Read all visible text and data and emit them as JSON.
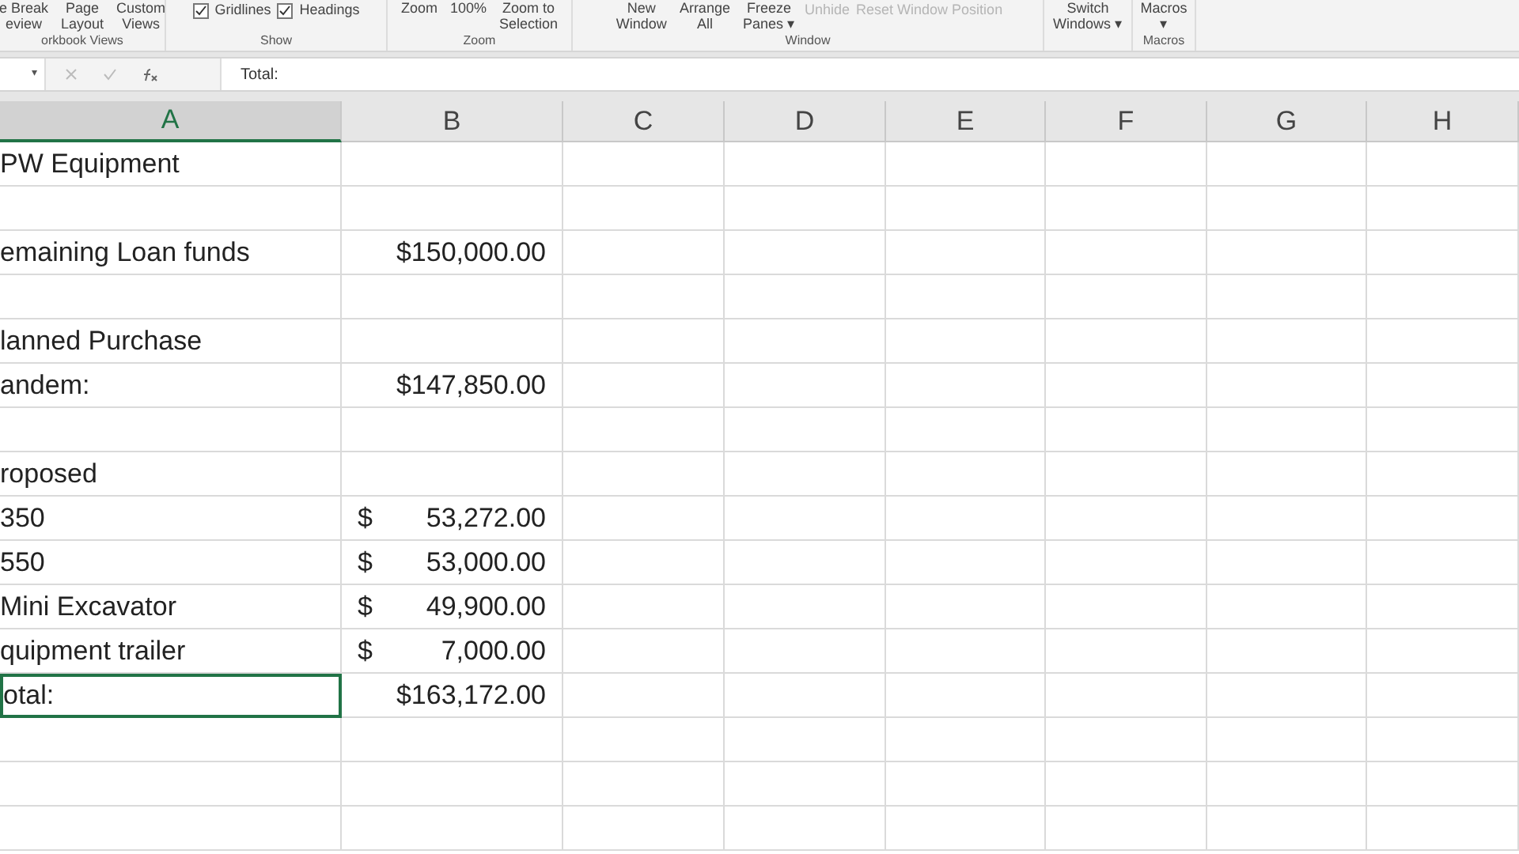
{
  "ribbon": {
    "groups": [
      {
        "label": "orkbook Views",
        "items": [
          {
            "kind": "button",
            "label": "e Break\neview"
          },
          {
            "kind": "button",
            "label": "Page\nLayout"
          },
          {
            "kind": "button",
            "label": "Custom\nViews"
          }
        ]
      },
      {
        "label": "Show",
        "items": [
          {
            "kind": "checkbox",
            "label": "Gridlines",
            "checked": true
          },
          {
            "kind": "checkbox",
            "label": "Headings",
            "checked": true
          }
        ]
      },
      {
        "label": "Zoom",
        "items": [
          {
            "kind": "button",
            "label": "Zoom"
          },
          {
            "kind": "button",
            "label": "100%"
          },
          {
            "kind": "button",
            "label": "Zoom to\nSelection"
          }
        ]
      },
      {
        "label": "Window",
        "items": [
          {
            "kind": "button",
            "label": "New\nWindow"
          },
          {
            "kind": "button",
            "label": "Arrange\nAll"
          },
          {
            "kind": "button",
            "label": "Freeze\nPanes ▾"
          },
          {
            "kind": "small",
            "label": "Unhide",
            "disabled": true
          },
          {
            "kind": "small",
            "label": "Reset Window Position",
            "disabled": true
          }
        ]
      },
      {
        "items": [
          {
            "kind": "button",
            "label": "Switch\nWindows ▾"
          }
        ]
      },
      {
        "label": "Macros",
        "items": [
          {
            "kind": "button",
            "label": "Macros\n▾"
          }
        ]
      }
    ]
  },
  "formula_bar": {
    "name_box_caret": "▾",
    "value": "Total:"
  },
  "columns": [
    {
      "label": "A",
      "selected": true
    },
    {
      "label": "B",
      "selected": false
    },
    {
      "label": "C",
      "selected": false
    },
    {
      "label": "D",
      "selected": false
    },
    {
      "label": "E",
      "selected": false
    },
    {
      "label": "F",
      "selected": false
    },
    {
      "label": "G",
      "selected": false
    },
    {
      "label": "H",
      "selected": false
    }
  ],
  "rows": [
    {
      "a": "PW Equipment",
      "selected": false
    },
    {
      "selected": false
    },
    {
      "a": "emaining Loan funds",
      "b": "$150,000.00",
      "selected": false
    },
    {
      "selected": false
    },
    {
      "a": "lanned Purchase",
      "selected": false
    },
    {
      "a": "andem:",
      "b": "$147,850.00",
      "selected": false
    },
    {
      "selected": false
    },
    {
      "a": "roposed",
      "selected": false
    },
    {
      "a": "350",
      "b_symbol": "$",
      "b_amount": "53,272.00",
      "selected": false
    },
    {
      "a": "550",
      "b_symbol": "$",
      "b_amount": "53,000.00",
      "selected": false
    },
    {
      "a": "Mini Excavator",
      "b_symbol": "$",
      "b_amount": "49,900.00",
      "selected": false
    },
    {
      "a": "quipment trailer",
      "b_symbol": "$",
      "b_amount": "7,000.00",
      "selected": false
    },
    {
      "a": "otal:",
      "b": "$163,172.00",
      "selected": true
    },
    {
      "selected": false
    },
    {
      "selected": false
    },
    {
      "selected": false
    }
  ]
}
